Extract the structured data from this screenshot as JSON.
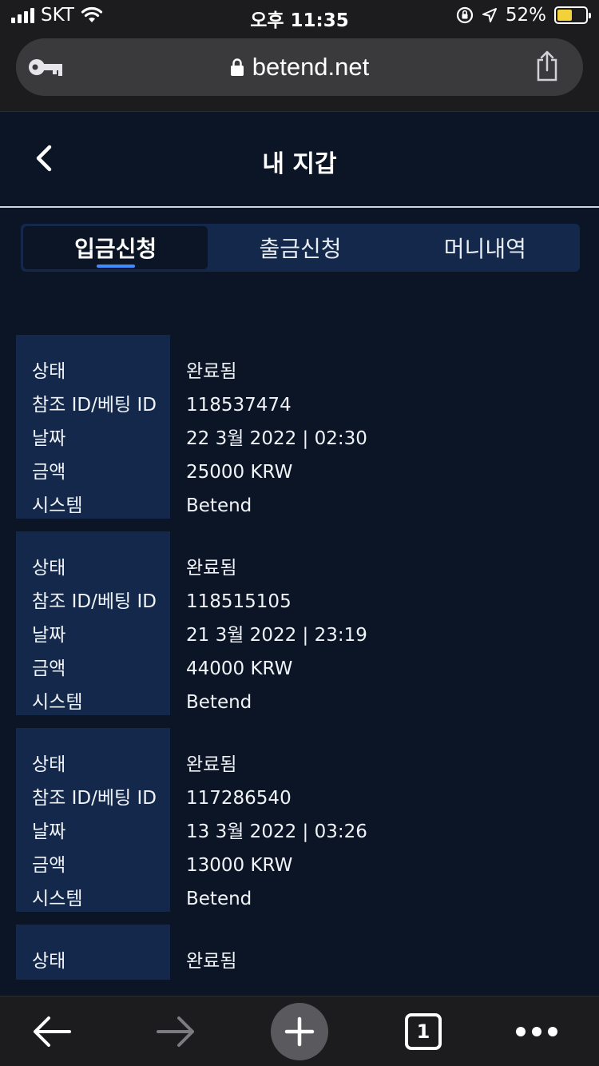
{
  "status_bar": {
    "carrier": "SKT",
    "time": "오후 11:35",
    "battery_percent": "52%",
    "battery_level": 0.52
  },
  "browser": {
    "url": "betend.net"
  },
  "header": {
    "title": "내 지갑"
  },
  "tabs": [
    {
      "label": "입금신청",
      "active": true
    },
    {
      "label": "출금신청",
      "active": false
    },
    {
      "label": "머니내역",
      "active": false
    }
  ],
  "labels": {
    "status": "상태",
    "ref_id": "참조 ID/베팅 ID",
    "date": "날짜",
    "amount": "금액",
    "system": "시스템"
  },
  "records": [
    {
      "status": "완료됨",
      "ref_id": "118537474",
      "date": "22 3월 2022 | 02:30",
      "amount": "25000 KRW",
      "system": "Betend"
    },
    {
      "status": "완료됨",
      "ref_id": "118515105",
      "date": "21 3월 2022 | 23:19",
      "amount": "44000 KRW",
      "system": "Betend"
    },
    {
      "status": "완료됨",
      "ref_id": "117286540",
      "date": "13 3월 2022 | 03:26",
      "amount": "13000 KRW",
      "system": "Betend"
    },
    {
      "status": "완료됨"
    }
  ],
  "toolbar": {
    "tab_count": "1"
  },
  "colors": {
    "background": "#0b1526",
    "panel": "#13284a",
    "accent": "#3f8cff"
  }
}
